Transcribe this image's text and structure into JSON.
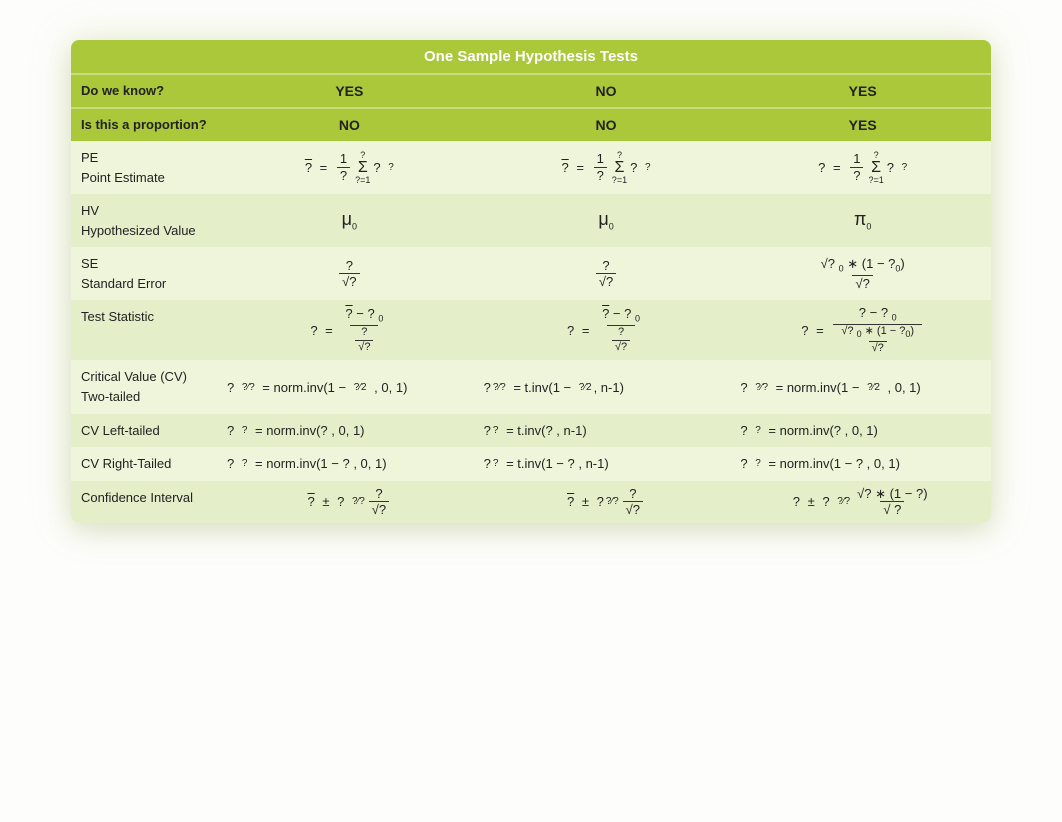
{
  "title": "One Sample Hypothesis Tests",
  "header_rows": [
    {
      "label": "Do we know?",
      "c1": "YES",
      "c2": "NO",
      "c3": "YES"
    },
    {
      "label": "Is this a proportion?",
      "c1": "NO",
      "c2": "NO",
      "c3": "YES"
    }
  ],
  "rows": {
    "pe": {
      "l1": "PE",
      "l2": "Point Estimate"
    },
    "hv": {
      "l1": "HV",
      "l2": "Hypothesized Value",
      "c1": "μ",
      "c2": "μ",
      "c3": "π",
      "sub": "0"
    },
    "se": {
      "l1": "SE",
      "l2": "Standard Error"
    },
    "ts": {
      "l1": "Test Statistic"
    },
    "cv2": {
      "l1": "Critical Value (CV)",
      "l2": "Two-tailed",
      "c1": "= norm.inv(1 −",
      "c1b": ", 0, 1)",
      "c2a": "= t.inv(1 −",
      "c2b": ", n-1)",
      "c3a": "= norm.inv(1 −",
      "c3b": ", 0, 1)"
    },
    "cvL": {
      "l1": "CV Left-tailed",
      "c1": "= norm.inv(? , 0, 1)",
      "c2": "= t.inv(? , n-1)",
      "c3": "= norm.inv(? , 0, 1)"
    },
    "cvR": {
      "l1": "CV Right-Tailed",
      "c1": "= norm.inv(1 − ?   , 0, 1)",
      "c2": "= t.inv(1 − ? , n-1)",
      "c3": "= norm.inv(1 − ?   , 0, 1)"
    },
    "ci": {
      "l1": "Confidence Interval"
    }
  },
  "sym": {
    "q": "?",
    "qbar": "?",
    "mu": "μ",
    "pi": "π",
    "sigma": "Σ",
    "sqrt": "√",
    "pm": "±",
    "minus": "−",
    "ast": "∗",
    "eq": "=",
    "one": "1",
    "zero": "0",
    "n": "n",
    "two": "2",
    "alpha2": "?⁄?",
    "sub_q": "?",
    "sub_a2": "?⁄?"
  }
}
